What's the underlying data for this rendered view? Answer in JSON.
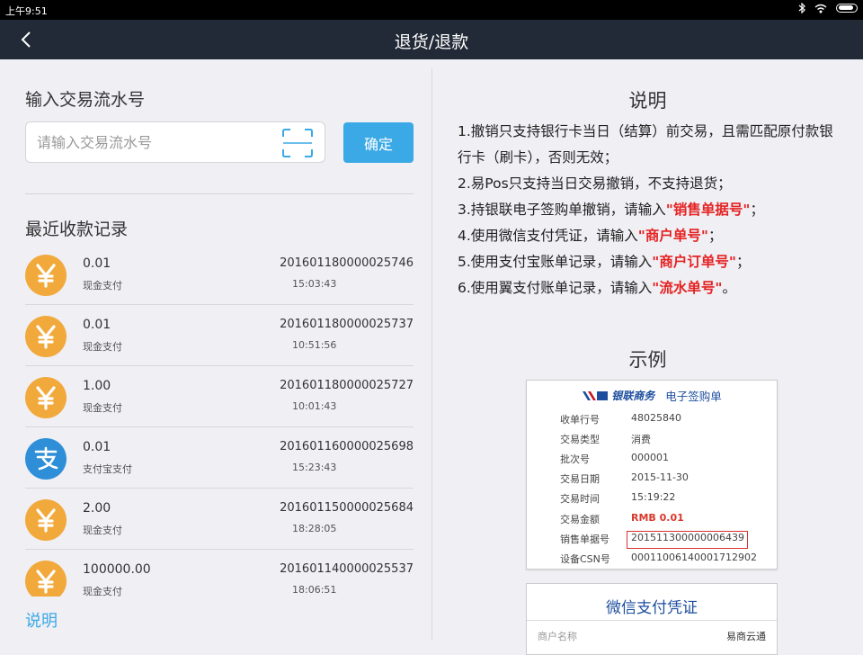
{
  "status_bar": {
    "time": "上午9:51"
  },
  "app_bar": {
    "title": "退货/退款"
  },
  "left": {
    "input_section_title": "输入交易流水号",
    "input_placeholder": "请输入交易流水号",
    "confirm_label": "确定",
    "records_title": "最近收款记录",
    "records": [
      {
        "icon": "yuan-icon",
        "amount": "0.01",
        "method": "现金支付",
        "number": "201601180000025746",
        "time": "15:03:43"
      },
      {
        "icon": "yuan-icon",
        "amount": "0.01",
        "method": "现金支付",
        "number": "201601180000025737",
        "time": "10:51:56"
      },
      {
        "icon": "yuan-icon",
        "amount": "1.00",
        "method": "现金支付",
        "number": "201601180000025727",
        "time": "10:01:43"
      },
      {
        "icon": "alipay-icon",
        "amount": "0.01",
        "method": "支付宝支付",
        "number": "201601160000025698",
        "time": "15:23:43"
      },
      {
        "icon": "yuan-icon",
        "amount": "2.00",
        "method": "现金支付",
        "number": "201601150000025684",
        "time": "18:28:05"
      },
      {
        "icon": "yuan-icon",
        "amount": "100000.00",
        "method": "现金支付",
        "number": "201601140000025537",
        "time": "18:06:51"
      }
    ],
    "explain_link": "说明"
  },
  "right": {
    "explain_title": "说明",
    "notes": [
      {
        "text": "1.撤销只支持银行卡当日（结算）前交易，且需匹配原付款银行卡（刷卡），否则无效；",
        "highlight": "",
        "suffix": ""
      },
      {
        "text": "2.易Pos只支持当日交易撤销，不支持退货；",
        "highlight": "",
        "suffix": ""
      },
      {
        "text": "3.持银联电子签购单撤销，请输入",
        "highlight": "\"销售单据号\"",
        "suffix": "；"
      },
      {
        "text": "4.使用微信支付凭证，请输入",
        "highlight": "\"商户单号\"",
        "suffix": "；"
      },
      {
        "text": "5.使用支付宝账单记录，请输入",
        "highlight": "\"商户订单号\"",
        "suffix": "；"
      },
      {
        "text": "6.使用翼支付账单记录，请输入",
        "highlight": "\"流水单号\"",
        "suffix": "。"
      }
    ],
    "example_title": "示例",
    "receipt": {
      "logo_text": "银联商务",
      "doc_name": "电子签购单",
      "rows": [
        {
          "label": "收单行号",
          "value": "48025840"
        },
        {
          "label": "交易类型",
          "value": "消费"
        },
        {
          "label": "批次号",
          "value": "000001"
        },
        {
          "label": "交易日期",
          "value": "2015-11-30"
        },
        {
          "label": "交易时间",
          "value": "15:19:22"
        },
        {
          "label": "交易金额",
          "value": "RMB  0.01"
        },
        {
          "label": "销售单据号",
          "value": "201511300000006439"
        },
        {
          "label": "设备CSN号",
          "value": "00011006140001712902"
        }
      ]
    },
    "wechat": {
      "title": "微信支付凭证",
      "merchant_label": "商户名称",
      "merchant_value": "易商云通"
    }
  },
  "colors": {
    "accent": "#3ba9e6",
    "appbar": "#222a37",
    "yuan": "#f2a93b",
    "alipay": "#2e8fd8",
    "highlight": "#e52222"
  }
}
